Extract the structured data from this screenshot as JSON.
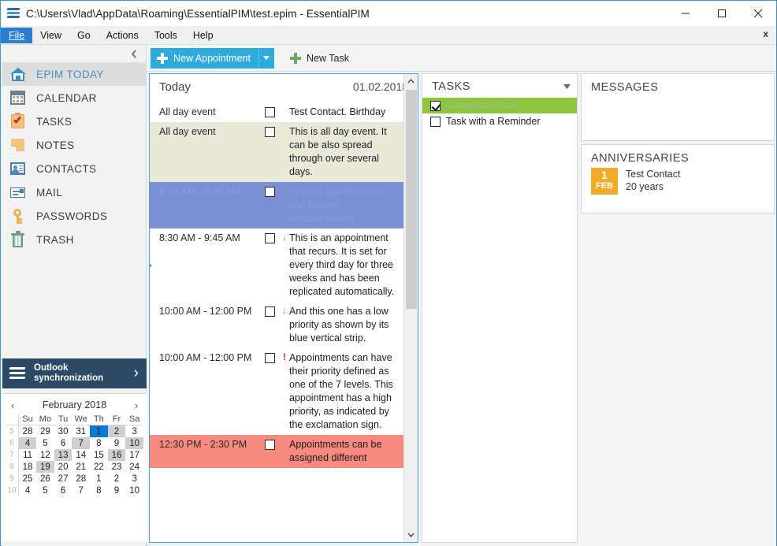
{
  "window": {
    "title": "C:\\Users\\Vlad\\AppData\\Roaming\\EssentialPIM\\test.epim - EssentialPIM",
    "minimize": "—",
    "maximize": "☐",
    "close": "✕"
  },
  "menu": {
    "items": [
      "File",
      "View",
      "Go",
      "Actions",
      "Tools",
      "Help"
    ],
    "active": "File",
    "close_label": "x"
  },
  "sidebar": {
    "collapse_icon": "‹",
    "items": [
      {
        "label": "EPIM TODAY",
        "icon": "home-icon",
        "selected": true
      },
      {
        "label": "CALENDAR",
        "icon": "calendar-icon",
        "selected": false
      },
      {
        "label": "TASKS",
        "icon": "task-icon",
        "selected": false
      },
      {
        "label": "NOTES",
        "icon": "note-icon",
        "selected": false
      },
      {
        "label": "CONTACTS",
        "icon": "contacts-icon",
        "selected": false
      },
      {
        "label": "MAIL",
        "icon": "mail-icon",
        "selected": false
      },
      {
        "label": "PASSWORDS",
        "icon": "key-icon",
        "selected": false
      },
      {
        "label": "TRASH",
        "icon": "trash-icon",
        "selected": false
      }
    ],
    "outlook": {
      "line1": "Outlook",
      "line2": "synchronization",
      "arrow": "›"
    }
  },
  "minicalendar": {
    "prev": "‹",
    "next": "›",
    "title": "February 2018",
    "weekday_headers": [
      "Su",
      "Mo",
      "Tu",
      "We",
      "Th",
      "Fr",
      "Sa"
    ],
    "week_numbers": [
      5,
      6,
      7,
      8,
      9,
      10
    ],
    "weeks": [
      [
        {
          "d": "28",
          "cls": "dimsun"
        },
        {
          "d": "29",
          "cls": "dim"
        },
        {
          "d": "30",
          "cls": "dim"
        },
        {
          "d": "31",
          "cls": "dim"
        },
        {
          "d": "1",
          "cls": "today"
        },
        {
          "d": "2",
          "cls": "hl"
        },
        {
          "d": "3",
          "cls": "sun"
        }
      ],
      [
        {
          "d": "4",
          "cls": "sun hl"
        },
        {
          "d": "5",
          "cls": ""
        },
        {
          "d": "6",
          "cls": ""
        },
        {
          "d": "7",
          "cls": "hl"
        },
        {
          "d": "8",
          "cls": ""
        },
        {
          "d": "9",
          "cls": ""
        },
        {
          "d": "10",
          "cls": "sun hl"
        }
      ],
      [
        {
          "d": "11",
          "cls": "sun"
        },
        {
          "d": "12",
          "cls": ""
        },
        {
          "d": "13",
          "cls": "hl"
        },
        {
          "d": "14",
          "cls": ""
        },
        {
          "d": "15",
          "cls": ""
        },
        {
          "d": "16",
          "cls": "hl"
        },
        {
          "d": "17",
          "cls": "sun"
        }
      ],
      [
        {
          "d": "18",
          "cls": "sun"
        },
        {
          "d": "19",
          "cls": "hl"
        },
        {
          "d": "20",
          "cls": ""
        },
        {
          "d": "21",
          "cls": ""
        },
        {
          "d": "22",
          "cls": ""
        },
        {
          "d": "23",
          "cls": ""
        },
        {
          "d": "24",
          "cls": "sun"
        }
      ],
      [
        {
          "d": "25",
          "cls": "sun"
        },
        {
          "d": "26",
          "cls": ""
        },
        {
          "d": "27",
          "cls": ""
        },
        {
          "d": "28",
          "cls": ""
        },
        {
          "d": "1",
          "cls": "dim"
        },
        {
          "d": "2",
          "cls": "dim"
        },
        {
          "d": "3",
          "cls": "dimsun"
        }
      ],
      [
        {
          "d": "4",
          "cls": "dimsun"
        },
        {
          "d": "5",
          "cls": "dim"
        },
        {
          "d": "6",
          "cls": "dim"
        },
        {
          "d": "7",
          "cls": "dim"
        },
        {
          "d": "8",
          "cls": "dim"
        },
        {
          "d": "9",
          "cls": "dim"
        },
        {
          "d": "10",
          "cls": "dimsun"
        }
      ]
    ]
  },
  "toolbar": {
    "new_appointment": "New Appointment",
    "new_appointment_dropdown": "▼",
    "new_task": "New Task"
  },
  "today_panel": {
    "title": "Today",
    "date": "01.02.2018",
    "appointments": [
      {
        "time": "All day event",
        "text": "Test Contact. Birthday",
        "priority": "",
        "row_style": "plain",
        "checked": false
      },
      {
        "time": "All day event",
        "text": "This is all day event. It can be also spread through over several days.",
        "priority": "",
        "row_style": "beige",
        "checked": false
      },
      {
        "time": "8:00 AM - 8:30 AM",
        "text": "Several appointments can happen simultaneously.",
        "priority": "",
        "row_style": "blue",
        "checked": false
      },
      {
        "time": "8:30 AM - 9:45 AM",
        "text": "This is an appointment that recurs. It is set for every third day for three weeks and has been replicated automatically.",
        "priority": "low",
        "priority_icon": "↓",
        "row_style": "plain",
        "checked": false,
        "marker": true
      },
      {
        "time": "10:00 AM - 12:00 PM",
        "text": "And this one has a low priority as shown by its blue vertical strip.",
        "priority": "low",
        "priority_icon": "↓",
        "row_style": "plain",
        "checked": false
      },
      {
        "time": "10:00 AM - 12:00 PM",
        "text": "Appointments can have their priority defined as one of the 7 levels. This appointment has a high priority, as indicated by the exclamation sign.",
        "priority": "high",
        "priority_icon": "!",
        "row_style": "plain",
        "checked": false
      },
      {
        "time": "12:30 PM - 2:30 PM",
        "text": "Appointments can be assigned different",
        "priority": "",
        "row_style": "red",
        "checked": false
      }
    ],
    "scroll_up": "⌃",
    "scroll_down": "⌄"
  },
  "tasks_panel": {
    "title": "TASKS",
    "dropdown_icon": "▼",
    "tasks": [
      {
        "label": "Completed Task",
        "completed": true
      },
      {
        "label": "Task with a Reminder",
        "completed": false
      }
    ]
  },
  "messages_panel": {
    "title": "MESSAGES"
  },
  "anniversaries_panel": {
    "title": "ANNIVERSARIES",
    "entries": [
      {
        "day": "1",
        "month": "FEB",
        "name": "Test Contact",
        "years": "20 years"
      }
    ]
  },
  "colors": {
    "accent_blue": "#2eaadc",
    "selected_blue": "#0b7ad4",
    "task_done_green": "#8cc63f",
    "anniversary_orange": "#f0ab28",
    "priority_high_red": "#d0342c",
    "priority_low_green": "#3aaa4a",
    "outlook_banner": "#2c4a66",
    "appt_beige": "#e9e9d9",
    "appt_blue": "#7b8fd6",
    "appt_red": "#f8897e"
  }
}
